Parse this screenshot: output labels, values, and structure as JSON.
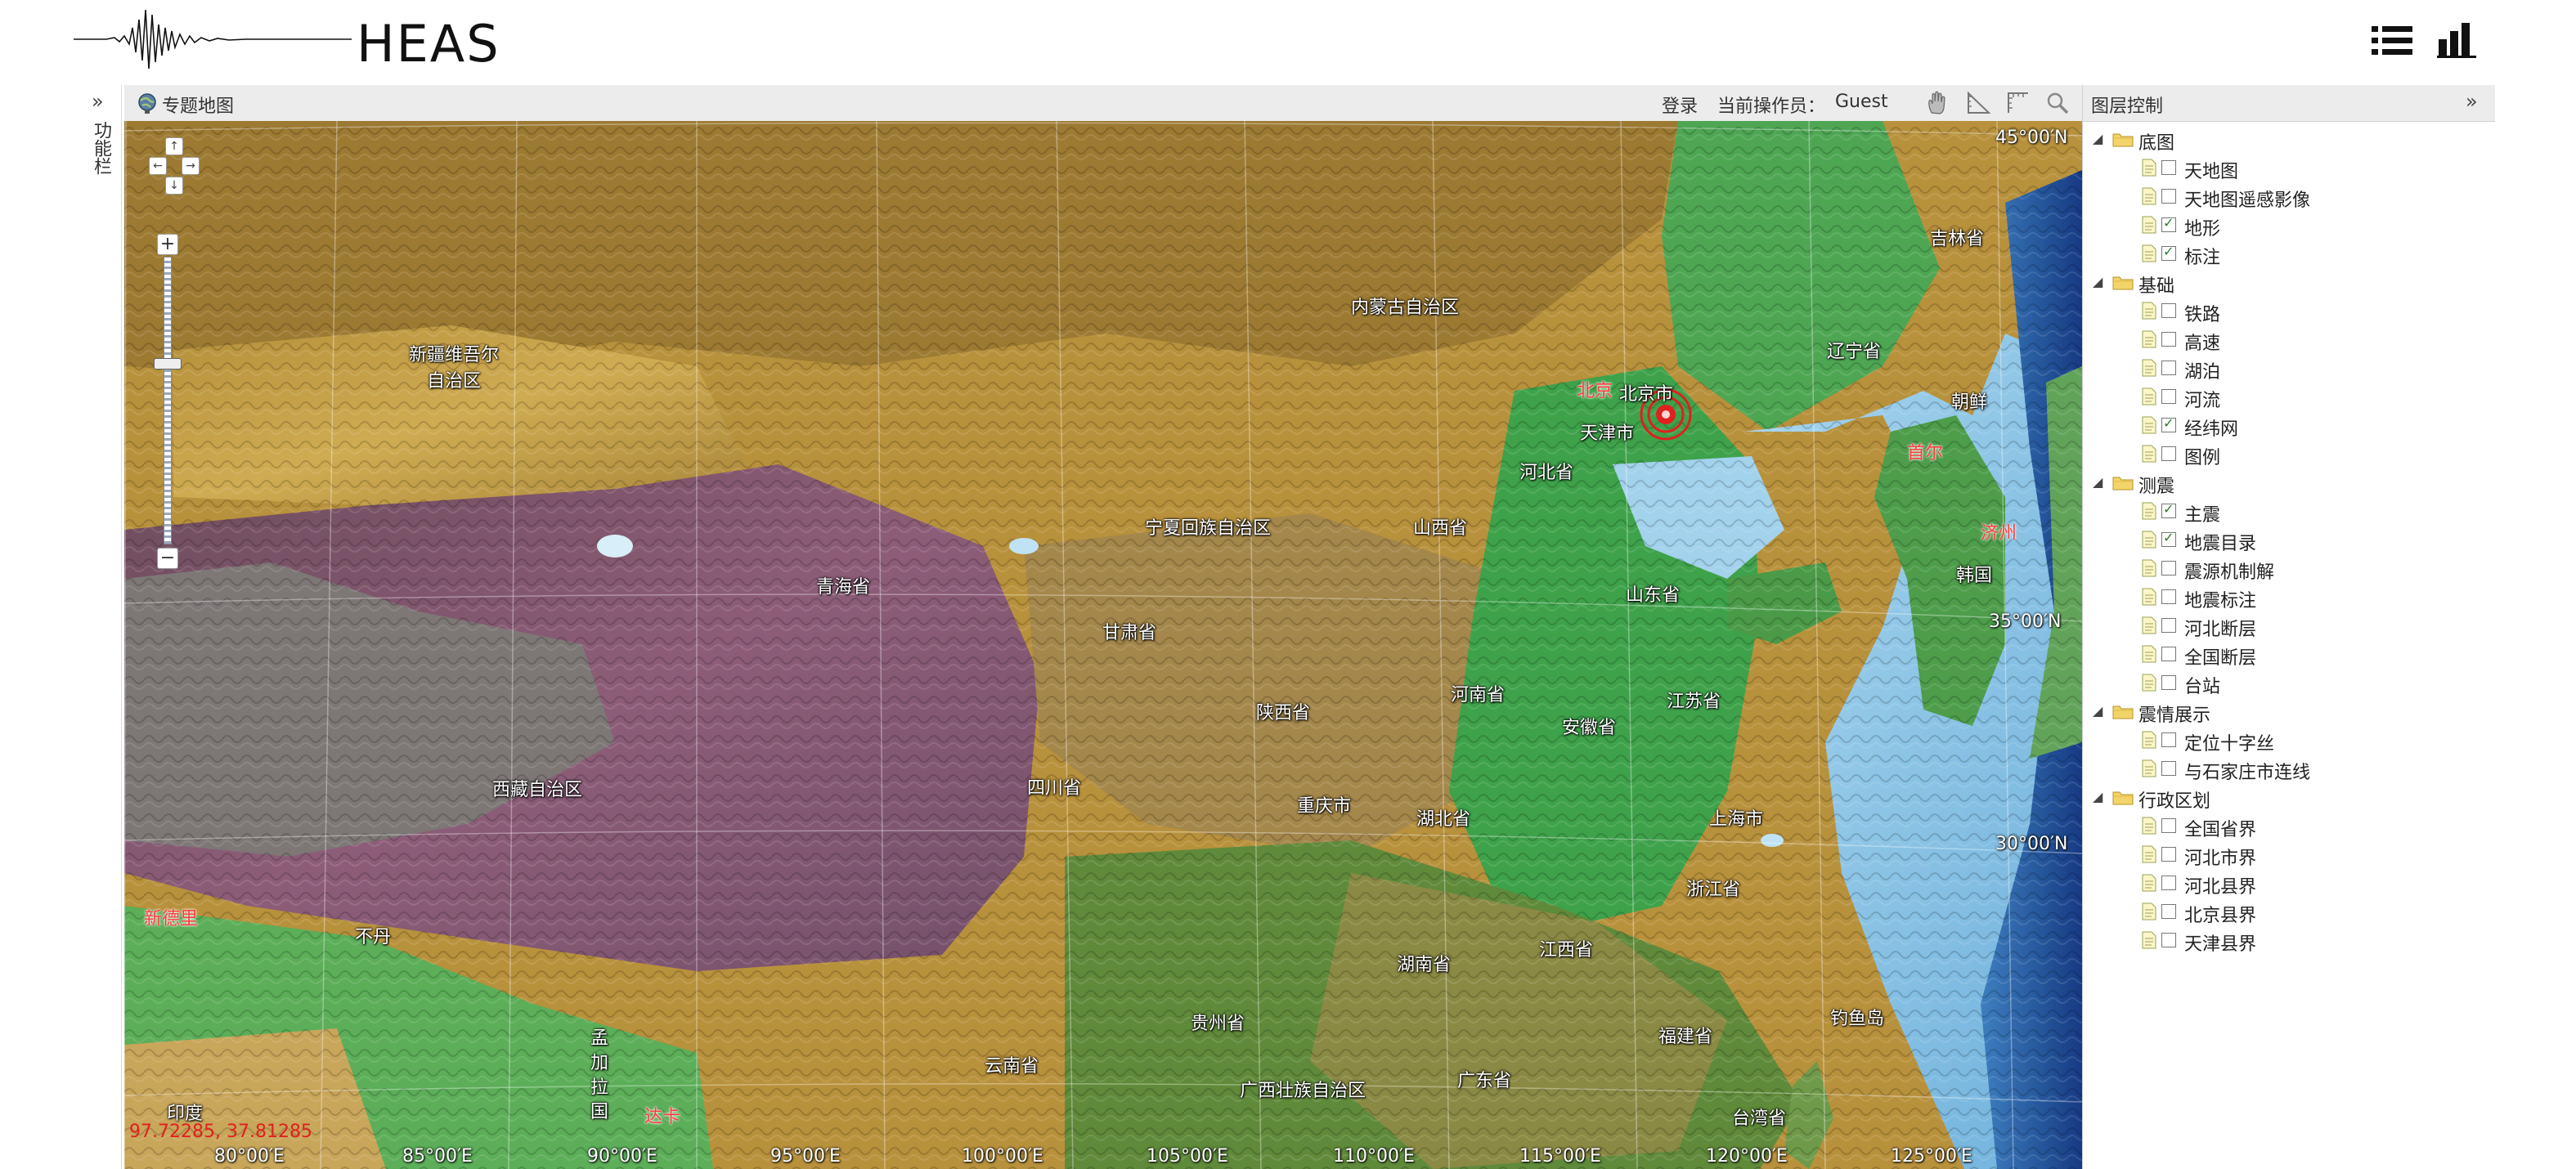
{
  "header": {
    "title": "HEAS",
    "list_icon": "list-icon",
    "chart_icon": "bar-chart-icon"
  },
  "func_bar": {
    "toggle": "»",
    "label": "功能栏"
  },
  "map_bar": {
    "title": "专题地图",
    "login": "登录",
    "operator_label": "当前操作员：",
    "operator_name": "Guest",
    "tools": [
      "hand-pan-icon",
      "measure-distance-icon",
      "measure-area-icon",
      "zoom-magnifier-icon"
    ]
  },
  "map": {
    "coordinate_readout": "97.72285, 37.81285",
    "zoom_level_fraction": 0.63,
    "nav_up": "↑",
    "nav_left": "←",
    "nav_right": "→",
    "nav_down": "↓",
    "zoom_in": "+",
    "zoom_out": "−",
    "places": {
      "xinjiang": "新疆维吾尔\n自治区",
      "neimenggu": "内蒙古自治区",
      "jilin": "吉林省",
      "liaoning": "辽宁省",
      "beijing_red": "北京",
      "beijing": "北京市",
      "tianjin": "天津市",
      "hebei": "河北省",
      "chaoxian": "朝鲜",
      "ningxia": "宁夏回族自治区",
      "shanxi": "山西省",
      "qinghai": "青海省",
      "shandong": "山东省",
      "gansu": "甘肃省",
      "hanguo": "韩国",
      "henan": "河南省",
      "jiangsu": "江苏省",
      "anhui": "安徽省",
      "shaanxi": "陕西省",
      "xizang": "西藏自治区",
      "sichuan": "四川省",
      "chongqing": "重庆市",
      "hubei": "湖北省",
      "shanghai": "上海市",
      "xinjiang_red": "新德里",
      "zhejiang": "浙江省",
      "hunan": "湖南省",
      "jiangxi": "江西省",
      "guizhou": "贵州省",
      "fujian": "福建省",
      "diaoyudao": "钓鱼岛",
      "yunnan": "云南省",
      "guangxi": "广西壮族自治区",
      "guangdong": "广东省",
      "taiwan": "台湾省",
      "yindu": "印度",
      "mengjiala": "孟\n加\n拉\n国",
      "dhaka": "达卡",
      "bhutan": "不丹",
      "seoul": "首尔",
      "jeju": "济州"
    },
    "grid_labels": {
      "lat45": "45°00′N",
      "lat35": "35°00′N",
      "lat30": "30°00′N",
      "lon80": "80°00′E",
      "lon85": "85°00′E",
      "lon90": "90°00′E",
      "lon95": "95°00′E",
      "lon100": "100°00′E",
      "lon105": "105°00′E",
      "lon110": "110°00′E",
      "lon115": "115°00′E",
      "lon120": "120°00′E",
      "lon125": "125°00′E"
    },
    "epicenter_icon": "earthquake-epicenter-icon",
    "colors": {
      "sea": "#9fd0ea",
      "lowland": "#3ea24a",
      "plateau": "#8a5a72",
      "desert": "#c9a64a",
      "accent_red": "#e0201e"
    }
  },
  "layers": {
    "title": "图层控制",
    "collapse": "»",
    "groups": [
      {
        "label": "底图",
        "items": [
          {
            "label": "天地图",
            "checked": false
          },
          {
            "label": "天地图遥感影像",
            "checked": false
          },
          {
            "label": "地形",
            "checked": true
          },
          {
            "label": "标注",
            "checked": true
          }
        ]
      },
      {
        "label": "基础",
        "items": [
          {
            "label": "铁路",
            "checked": false
          },
          {
            "label": "高速",
            "checked": false
          },
          {
            "label": "湖泊",
            "checked": false
          },
          {
            "label": "河流",
            "checked": false
          },
          {
            "label": "经纬网",
            "checked": true
          },
          {
            "label": "图例",
            "checked": false
          }
        ]
      },
      {
        "label": "测震",
        "items": [
          {
            "label": "主震",
            "checked": true
          },
          {
            "label": "地震目录",
            "checked": true
          },
          {
            "label": "震源机制解",
            "checked": false
          },
          {
            "label": "地震标注",
            "checked": false
          },
          {
            "label": "河北断层",
            "checked": false
          },
          {
            "label": "全国断层",
            "checked": false
          },
          {
            "label": "台站",
            "checked": false
          }
        ]
      },
      {
        "label": "震情展示",
        "items": [
          {
            "label": "定位十字丝",
            "checked": false
          },
          {
            "label": "与石家庄市连线",
            "checked": false
          }
        ]
      },
      {
        "label": "行政区划",
        "items": [
          {
            "label": "全国省界",
            "checked": false
          },
          {
            "label": "河北市界",
            "checked": false
          },
          {
            "label": "河北县界",
            "checked": false
          },
          {
            "label": "北京县界",
            "checked": false
          },
          {
            "label": "天津县界",
            "checked": false
          }
        ]
      }
    ]
  }
}
